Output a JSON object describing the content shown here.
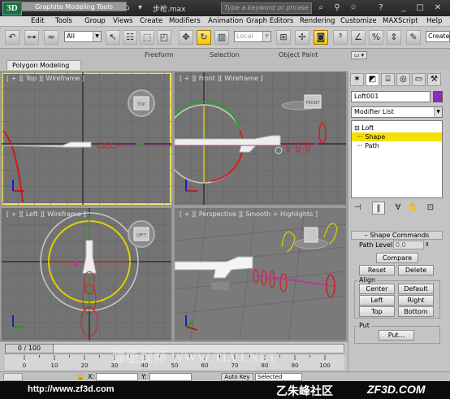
{
  "title_bar": {
    "app_logo": "3D",
    "doc_title": "步枪.max",
    "search_placeholder": "Type a keyword or phrase"
  },
  "menu": [
    "Edit",
    "Tools",
    "Group",
    "Views",
    "Create",
    "Modifiers",
    "Animation",
    "Graph Editors",
    "Rendering",
    "Customize",
    "MAXScript",
    "Help"
  ],
  "toolbar": {
    "selection_filter": "All",
    "ref_coord": "Local",
    "create_sel_set": "Create"
  },
  "ribbon": {
    "tabs": [
      "Graphite Modeling Tools",
      "Freeform",
      "Selection",
      "Object Paint"
    ],
    "sub_tab": "Polygon Modeling"
  },
  "viewports": {
    "top": {
      "label": "[ + ][ Top ][ Wireframe ]",
      "cube": "TOP"
    },
    "front": {
      "label": "[ + ][ Front ][ Wireframe ]",
      "cube": "FRONT"
    },
    "left": {
      "label": "[ + ][ Left ][ Wireframe ]",
      "cube": "LEFT"
    },
    "perspective": {
      "label": "[ + ][ Perspective ][ Smooth + Highlights ]"
    }
  },
  "command_panel": {
    "object_name": "Loft001",
    "object_color": "#8a2bbd",
    "modifier_list": "Modifier List",
    "stack": [
      {
        "label": "Loft",
        "prefix": "⊟"
      },
      {
        "label": "Shape",
        "prefix": "···"
      },
      {
        "label": "Path",
        "prefix": "···"
      }
    ],
    "rollout_title": "Shape Commands",
    "path_level_label": "Path Level:",
    "path_level_value": "0.0",
    "compare_button": "Compare",
    "reset_button": "Reset",
    "delete_button": "Delete",
    "align_group": "Align",
    "align_buttons": [
      "Center",
      "Default",
      "Left",
      "Right",
      "Top",
      "Bottom"
    ],
    "put_group": "Put",
    "put_button": "Put..."
  },
  "timeline": {
    "slider": "0 / 100",
    "ticks": [
      "0",
      "10",
      "20",
      "30",
      "40",
      "50",
      "60",
      "70",
      "80",
      "90",
      "100"
    ]
  },
  "status": {
    "x_label": "X:",
    "y_label": "Y:",
    "auto_key": "Auto Key",
    "selected": "Selected"
  },
  "watermark": "猫能视频 WWW.TLVI.NET",
  "footer": {
    "url": "http://www.zf3d.com",
    "brand": "乙朱峰社区",
    "site": "ZF3D.COM"
  }
}
